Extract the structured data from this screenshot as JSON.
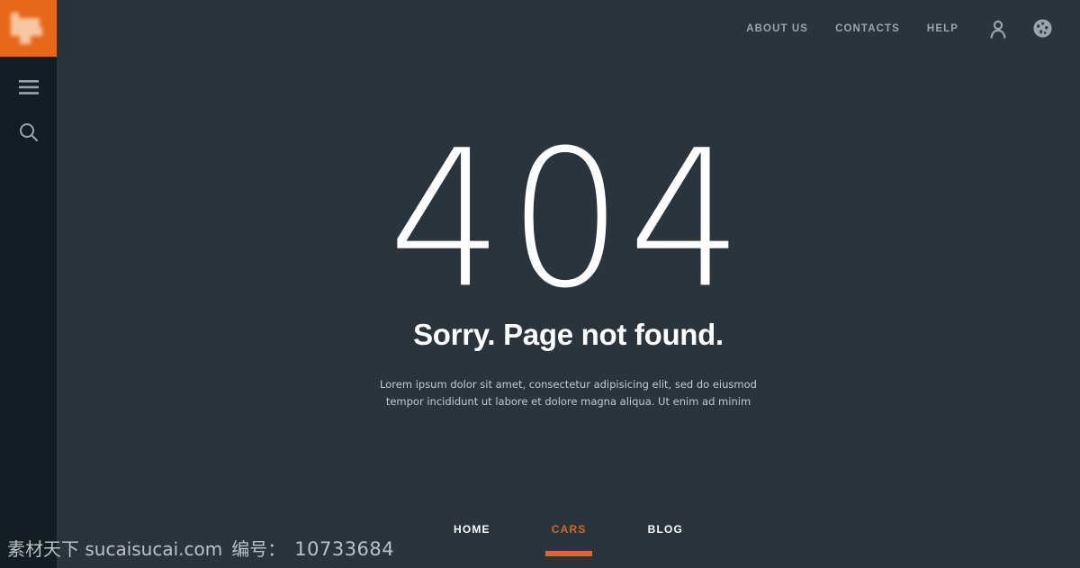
{
  "theme": {
    "background": "#29343d",
    "sidebar_background": "#131e24",
    "accent_orange": "#e7671b",
    "active_tab_color": "#d2682a",
    "nav_text_color": "#9aa5ad",
    "body_text_color": "#c3cad0"
  },
  "sidebar": {
    "logo": {
      "name": "site-logo",
      "background": "#e7671b"
    },
    "items": [
      {
        "icon": "hamburger-menu-icon",
        "label": "Menu"
      },
      {
        "icon": "search-icon",
        "label": "Search"
      }
    ]
  },
  "topnav": {
    "links": [
      {
        "label": "ABOUT US"
      },
      {
        "label": "CONTACTS"
      },
      {
        "label": "HELP"
      }
    ],
    "icons": [
      {
        "name": "user-account-icon"
      },
      {
        "name": "globe-language-icon"
      }
    ]
  },
  "main": {
    "error_code": "404",
    "title": "Sorry. Page not found.",
    "description": "Lorem ipsum dolor sit amet, consectetur adipisicing elit, sed do eiusmod tempor incididunt ut labore et dolore magna aliqua. Ut enim ad minim"
  },
  "bottomnav": {
    "items": [
      {
        "label": "HOME",
        "active": false
      },
      {
        "label": "CARS",
        "active": true
      },
      {
        "label": "BLOG",
        "active": false
      }
    ]
  },
  "watermark": {
    "site": "素材天下 sucaisucai.com",
    "id_label": "编号：",
    "id_value": "10733684"
  }
}
